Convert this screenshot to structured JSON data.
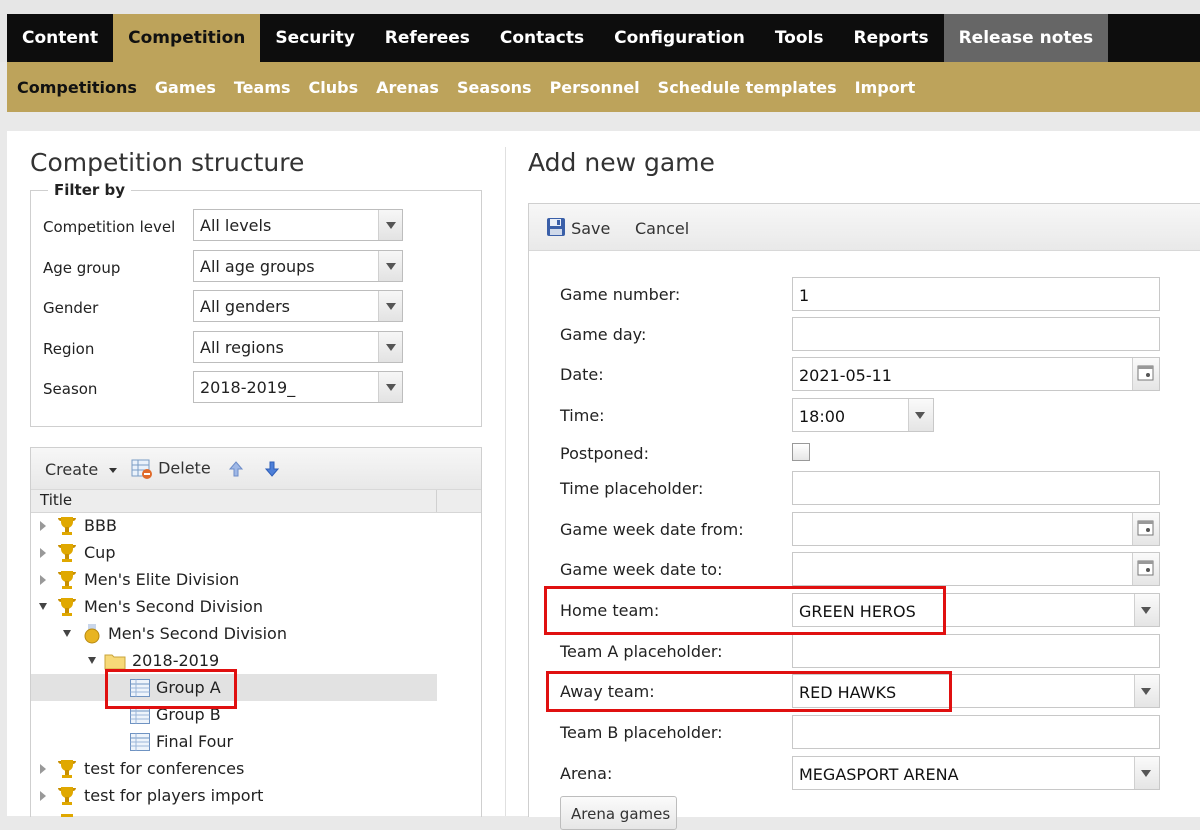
{
  "main_nav": [
    {
      "label": "Content"
    },
    {
      "label": "Competition",
      "active": true
    },
    {
      "label": "Security"
    },
    {
      "label": "Referees"
    },
    {
      "label": "Contacts"
    },
    {
      "label": "Configuration"
    },
    {
      "label": "Tools"
    },
    {
      "label": "Reports"
    },
    {
      "label": "Release notes"
    }
  ],
  "sub_nav": [
    {
      "label": "Competitions",
      "active": true
    },
    {
      "label": "Games"
    },
    {
      "label": "Teams"
    },
    {
      "label": "Clubs"
    },
    {
      "label": "Arenas"
    },
    {
      "label": "Seasons"
    },
    {
      "label": "Personnel"
    },
    {
      "label": "Schedule templates"
    },
    {
      "label": "Import"
    }
  ],
  "left": {
    "title": "Competition structure",
    "filter": {
      "legend": "Filter by",
      "fields": [
        {
          "label": "Competition level",
          "value": "All levels"
        },
        {
          "label": "Age group",
          "value": "All age groups"
        },
        {
          "label": "Gender",
          "value": "All genders"
        },
        {
          "label": "Region",
          "value": "All regions"
        },
        {
          "label": "Season",
          "value": "2018-2019_"
        }
      ]
    },
    "tree_toolbar": {
      "create": "Create",
      "delete": "Delete"
    },
    "tree_header": "Title",
    "tree": [
      {
        "label": "BBB",
        "icon": "trophy-icon"
      },
      {
        "label": "Cup",
        "icon": "trophy-icon"
      },
      {
        "label": "Men's Elite Division",
        "icon": "trophy-icon"
      },
      {
        "label": "Men's Second Division",
        "icon": "trophy-icon"
      },
      {
        "label": "Men's Second Division",
        "icon": "medal-icon"
      },
      {
        "label": "2018-2019",
        "icon": "folder-icon"
      },
      {
        "label": "Group A",
        "icon": "table-icon",
        "selected": true
      },
      {
        "label": "Group B",
        "icon": "table-icon"
      },
      {
        "label": "Final Four",
        "icon": "table-icon"
      },
      {
        "label": "test for conferences",
        "icon": "trophy-icon"
      },
      {
        "label": "test for players import",
        "icon": "trophy-icon"
      }
    ]
  },
  "right": {
    "title": "Add new game",
    "toolbar": {
      "save": "Save",
      "cancel": "Cancel"
    },
    "fields": [
      {
        "label": "Game number:",
        "value": "1",
        "type": "text"
      },
      {
        "label": "Game day:",
        "value": "",
        "type": "text"
      },
      {
        "label": "Date:",
        "value": "2021-05-11",
        "type": "date"
      },
      {
        "label": "Time:",
        "value": "18:00",
        "type": "time"
      },
      {
        "label": "Postponed:",
        "value": "",
        "type": "checkbox"
      },
      {
        "label": "Time placeholder:",
        "value": "",
        "type": "text"
      },
      {
        "label": "Game week date from:",
        "value": "",
        "type": "date"
      },
      {
        "label": "Game week date to:",
        "value": "",
        "type": "date"
      },
      {
        "label": "Home team:",
        "value": "GREEN HEROS",
        "type": "select"
      },
      {
        "label": "Team A placeholder:",
        "value": "",
        "type": "text"
      },
      {
        "label": "Away team:",
        "value": "RED HAWKS",
        "type": "select"
      },
      {
        "label": "Team B placeholder:",
        "value": "",
        "type": "text"
      },
      {
        "label": "Arena:",
        "value": "MEGASPORT ARENA",
        "type": "select"
      }
    ],
    "arena_games_button": "Arena games"
  },
  "colors": {
    "nav_bg": "#0d0d0d",
    "accent_gold": "#bda35b",
    "highlight_red": "#e01010"
  }
}
